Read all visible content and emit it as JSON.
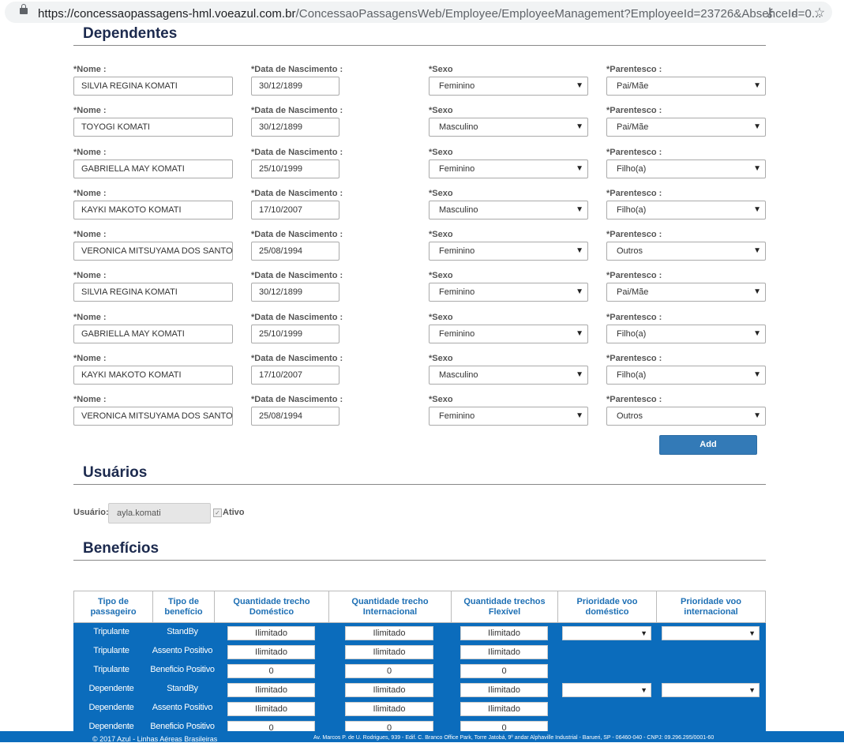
{
  "browser": {
    "url_host": "https://concessaopassagens-hml.voeazul.com.br",
    "url_path": "/ConcessaoPassagensWeb/Employee/EmployeeManagement?EmployeeId=23726&AbsenceId=0..."
  },
  "dependentes": {
    "title": "Dependentes",
    "labels": {
      "nome": "*Nome :",
      "nascimento": "*Data de Nascimento :",
      "sexo": "*Sexo",
      "parentesco": "*Parentesco :"
    },
    "rows": [
      {
        "nome": "SILVIA REGINA  KOMATI",
        "nascimento": "30/12/1899",
        "sexo": "Feminino",
        "parentesco": "Pai/Mãe"
      },
      {
        "nome": "TOYOGI KOMATI",
        "nascimento": "30/12/1899",
        "sexo": "Masculino",
        "parentesco": "Pai/Mãe"
      },
      {
        "nome": "GABRIELLA MAY  KOMATI",
        "nascimento": "25/10/1999",
        "sexo": "Feminino",
        "parentesco": "Filho(a)"
      },
      {
        "nome": "KAYKI MAKOTO  KOMATI",
        "nascimento": "17/10/2007",
        "sexo": "Masculino",
        "parentesco": "Filho(a)"
      },
      {
        "nome": "VERONICA MITSUYAMA DOS  SANTO",
        "nascimento": "25/08/1994",
        "sexo": "Feminino",
        "parentesco": "Outros"
      },
      {
        "nome": "SILVIA REGINA KOMATI",
        "nascimento": "30/12/1899",
        "sexo": "Feminino",
        "parentesco": "Pai/Mãe"
      },
      {
        "nome": "GABRIELLA MAY KOMATI",
        "nascimento": "25/10/1999",
        "sexo": "Feminino",
        "parentesco": "Filho(a)"
      },
      {
        "nome": "KAYKI MAKOTO KOMATI",
        "nascimento": "17/10/2007",
        "sexo": "Masculino",
        "parentesco": "Filho(a)"
      },
      {
        "nome": "VERONICA MITSUYAMA DOS SANTOS",
        "nascimento": "25/08/1994",
        "sexo": "Feminino",
        "parentesco": "Outros"
      }
    ],
    "add_label": "Add"
  },
  "usuarios": {
    "title": "Usuários",
    "user_label": "Usuário:",
    "user_value": "ayla.komati",
    "ativo_label": "Ativo",
    "ativo_checked": true
  },
  "beneficios": {
    "title": "Benefícios",
    "headers": [
      "Tipo de passageiro",
      "Tipo de benefício",
      "Quantidade trecho Doméstico",
      "Quantidade trecho Internacional",
      "Quantidade trechos Flexível",
      "Prioridade voo doméstico",
      "Prioridade voo internacional"
    ],
    "rows": [
      {
        "passageiro": "Tripulante",
        "beneficio": "StandBy",
        "domestico": "Ilimitado",
        "internacional": "Ilimitado",
        "flexivel": "Ilimitado",
        "has_priority": true
      },
      {
        "passageiro": "Tripulante",
        "beneficio": "Assento Positivo",
        "domestico": "Ilimitado",
        "internacional": "Ilimitado",
        "flexivel": "Ilimitado",
        "has_priority": false
      },
      {
        "passageiro": "Tripulante",
        "beneficio": "Beneficio Positivo",
        "domestico": "0",
        "internacional": "0",
        "flexivel": "0",
        "has_priority": false
      },
      {
        "passageiro": "Dependente",
        "beneficio": "StandBy",
        "domestico": "Ilimitado",
        "internacional": "Ilimitado",
        "flexivel": "Ilimitado",
        "has_priority": true
      },
      {
        "passageiro": "Dependente",
        "beneficio": "Assento Positivo",
        "domestico": "Ilimitado",
        "internacional": "Ilimitado",
        "flexivel": "Ilimitado",
        "has_priority": false
      },
      {
        "passageiro": "Dependente",
        "beneficio": "Beneficio Positivo",
        "domestico": "0",
        "internacional": "0",
        "flexivel": "0",
        "has_priority": false
      }
    ]
  },
  "footer": {
    "left": "© 2017 Azul - Linhas Aéreas Brasileiras",
    "right": "Av. Marcos P. de U. Rodrigues, 939 - Edif. C. Branco Office Park, Torre Jatobá, 9º andar Alphaville Industrial - Barueri, SP - 06460-040 - CNPJ: 09.296.295/0001-60"
  },
  "colors": {
    "accent": "#337ab7",
    "table_bg": "#0b6cbc",
    "header_text": "#1d6fb4",
    "section_title": "#1c2a4e"
  }
}
